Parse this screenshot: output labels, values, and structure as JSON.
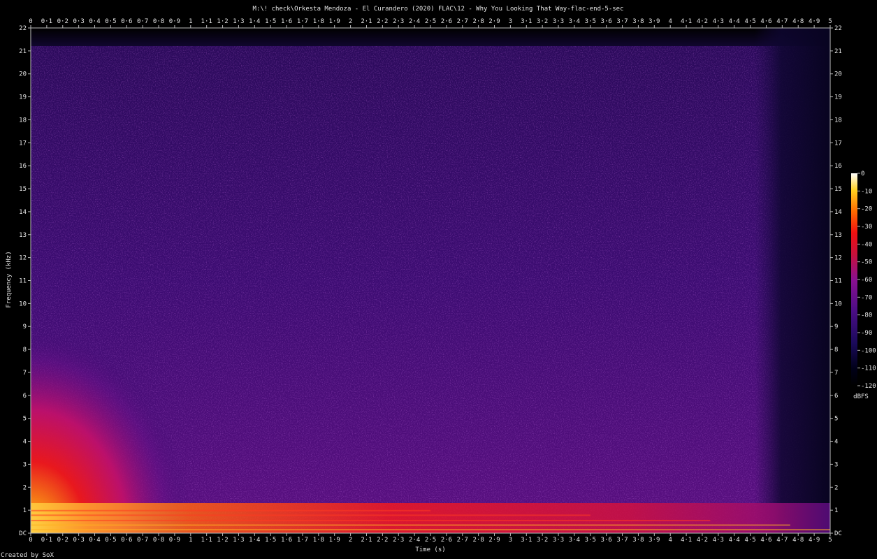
{
  "chart_data": {
    "type": "heatmap",
    "title": "M:\\! check\\Orkesta Mendoza - El Curandero (2020) FLAC\\12 - Why You Looking That Way-flac-end-5-sec",
    "xlabel": "Time (s)",
    "ylabel": "Frequency (kHz)",
    "xlim": [
      0,
      5
    ],
    "ylim": [
      0,
      22
    ],
    "x_ticks": [
      "0",
      "0·1",
      "0·2",
      "0·3",
      "0·4",
      "0·5",
      "0·6",
      "0·7",
      "0·8",
      "0·9",
      "1",
      "1·1",
      "1·2",
      "1·3",
      "1·4",
      "1·5",
      "1·6",
      "1·7",
      "1·8",
      "1·9",
      "2",
      "2·1",
      "2·2",
      "2·3",
      "2·4",
      "2·5",
      "2·6",
      "2·7",
      "2·8",
      "2·9",
      "3",
      "3·1",
      "3·2",
      "3·3",
      "3·4",
      "3·5",
      "3·6",
      "3·7",
      "3·8",
      "3·9",
      "4",
      "4·1",
      "4·2",
      "4·3",
      "4·4",
      "4·5",
      "4·6",
      "4·7",
      "4·8",
      "4·9",
      "5"
    ],
    "y_ticks": [
      "DC",
      "1",
      "2",
      "3",
      "4",
      "5",
      "6",
      "7",
      "8",
      "9",
      "10",
      "11",
      "12",
      "13",
      "14",
      "15",
      "16",
      "17",
      "18",
      "19",
      "20",
      "21",
      "22"
    ],
    "colorbar": {
      "label": "dBFS",
      "range": [
        -120,
        0
      ],
      "ticks": [
        "0",
        "-10",
        "-20",
        "-30",
        "-40",
        "-50",
        "-60",
        "-70",
        "-80",
        "-90",
        "-100",
        "-110",
        "-120"
      ]
    },
    "regions": [
      {
        "t": [
          0,
          0.9
        ],
        "f": [
          0,
          8.5
        ],
        "level_db": -45
      },
      {
        "t": [
          0,
          5
        ],
        "f": [
          0,
          1
        ],
        "level_db": -40
      },
      {
        "t": [
          0,
          4.6
        ],
        "f": [
          1,
          21.5
        ],
        "level_db": -95
      },
      {
        "t": [
          4.6,
          5
        ],
        "f": [
          1,
          21.5
        ],
        "level_db": -115
      }
    ]
  },
  "footer": {
    "credit": "Created by SoX"
  }
}
